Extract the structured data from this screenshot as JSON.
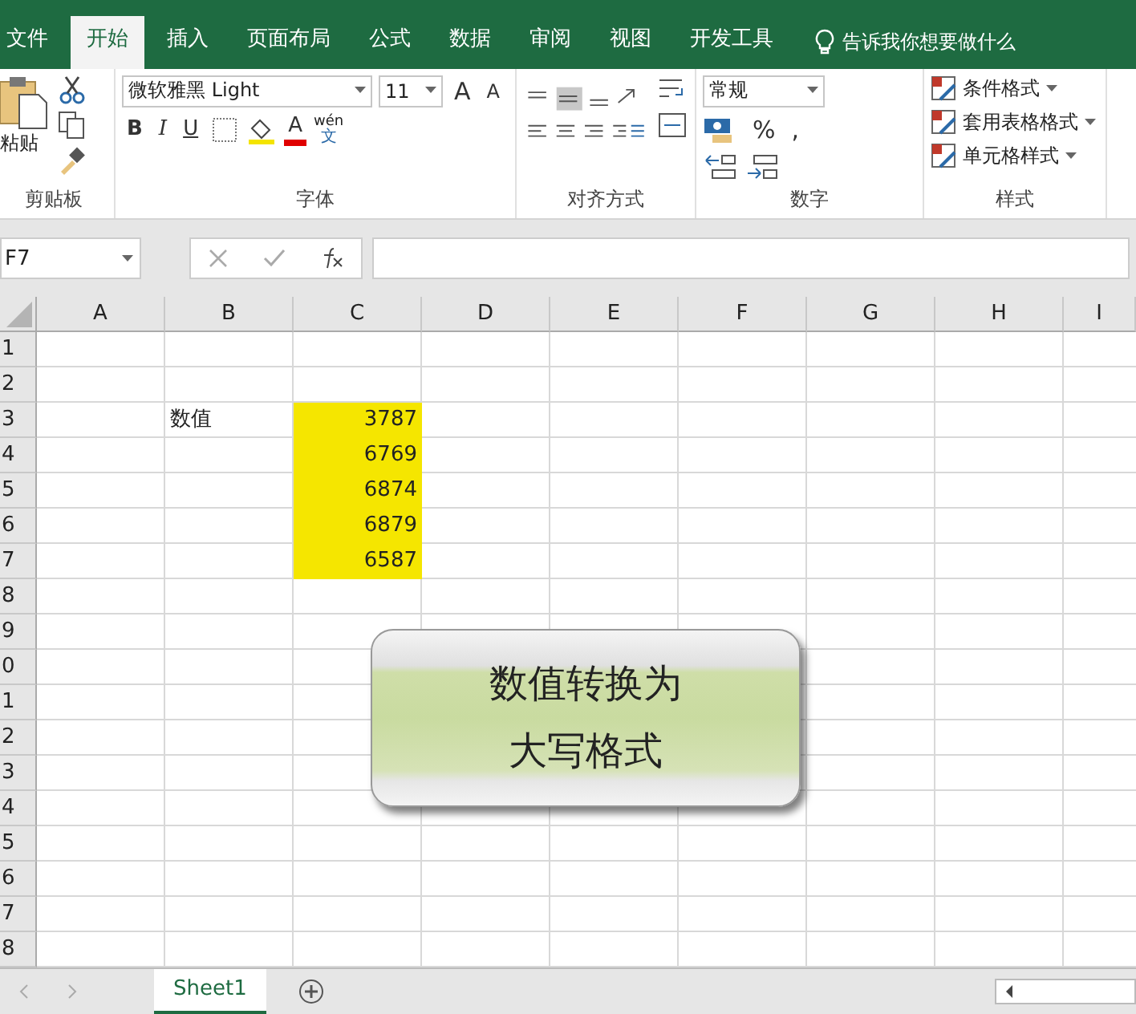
{
  "tabs": [
    {
      "label": "文件",
      "selected": false
    },
    {
      "label": "开始",
      "selected": true
    },
    {
      "label": "插入",
      "selected": false
    },
    {
      "label": "页面布局",
      "selected": false
    },
    {
      "label": "公式",
      "selected": false
    },
    {
      "label": "数据",
      "selected": false
    },
    {
      "label": "审阅",
      "selected": false
    },
    {
      "label": "视图",
      "selected": false
    },
    {
      "label": "开发工具",
      "selected": false
    }
  ],
  "tell_me": "告诉我你想要做什么",
  "ribbon": {
    "clipboard": {
      "paste": "粘贴",
      "label": "剪贴板"
    },
    "font": {
      "font_name": "微软雅黑 Light",
      "font_size": "11",
      "grow": "A",
      "shrink": "A",
      "bold": "B",
      "italic": "I",
      "underline": "U",
      "font_color": "A",
      "phonetic_top": "wén",
      "phonetic_bottom": "文",
      "label": "字体"
    },
    "alignment": {
      "label": "对齐方式"
    },
    "number": {
      "format": "常规",
      "percent": "%",
      "comma": ",",
      "label": "数字"
    },
    "styles": {
      "items": [
        "条件格式",
        "套用表格格式",
        "单元格样式"
      ],
      "label": "样式"
    }
  },
  "formula_bar": {
    "name_box": "F7"
  },
  "columns": [
    "A",
    "B",
    "C",
    "D",
    "E",
    "F",
    "G",
    "H",
    "I"
  ],
  "rows": [
    {
      "number": "1"
    },
    {
      "number": "2"
    },
    {
      "number": "3",
      "label": "数值",
      "value": {
        "text": "3787",
        "highlighted": true
      }
    },
    {
      "number": "4",
      "value": {
        "text": "6769",
        "highlighted": true
      }
    },
    {
      "number": "5",
      "value": {
        "text": "6874",
        "highlighted": true
      }
    },
    {
      "number": "6",
      "value": {
        "text": "6879",
        "highlighted": true
      }
    },
    {
      "number": "7",
      "value": {
        "text": "6587",
        "highlighted": true
      }
    },
    {
      "number": "8"
    },
    {
      "number": "9"
    },
    {
      "number": "0"
    },
    {
      "number": "1"
    },
    {
      "number": "2"
    },
    {
      "number": "3"
    },
    {
      "number": "4"
    },
    {
      "number": "5"
    },
    {
      "number": "6"
    },
    {
      "number": "7"
    },
    {
      "number": "8"
    }
  ],
  "callout": {
    "lines": [
      "数值转换为",
      "大写格式"
    ]
  },
  "sheet_tabs": [
    {
      "label": "Sheet1",
      "selected": true
    }
  ]
}
